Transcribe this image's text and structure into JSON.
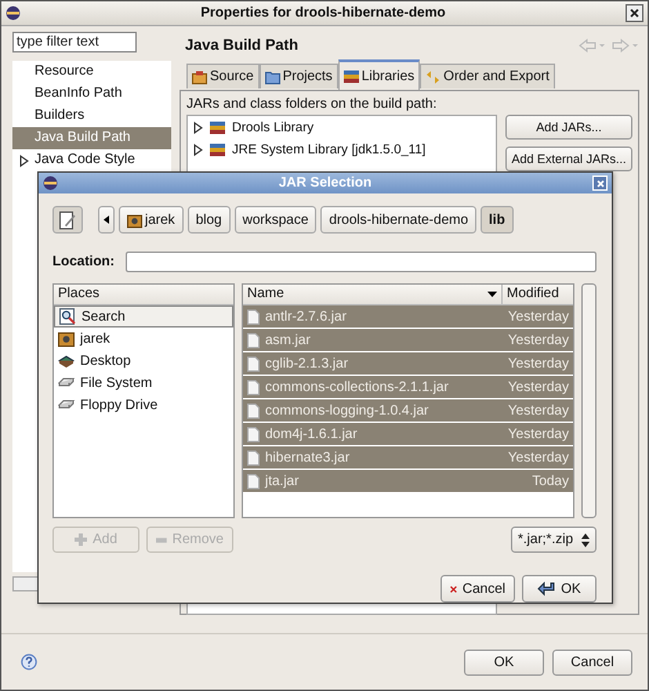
{
  "window": {
    "title": "Properties for drools-hibernate-demo"
  },
  "filter": {
    "placeholder": "type filter text"
  },
  "nav_items": [
    {
      "label": "Resource",
      "selected": false,
      "expandable": false
    },
    {
      "label": "BeanInfo Path",
      "selected": false,
      "expandable": false
    },
    {
      "label": "Builders",
      "selected": false,
      "expandable": false
    },
    {
      "label": "Java Build Path",
      "selected": true,
      "expandable": false
    },
    {
      "label": "Java Code Style",
      "selected": false,
      "expandable": true
    }
  ],
  "page": {
    "title": "Java Build Path"
  },
  "tabs": [
    {
      "label": "Source",
      "selected": false,
      "kind": "source"
    },
    {
      "label": "Projects",
      "selected": false,
      "kind": "projects"
    },
    {
      "label": "Libraries",
      "selected": true,
      "kind": "libraries"
    },
    {
      "label": "Order and Export",
      "selected": false,
      "kind": "order"
    }
  ],
  "libraries_hint": "JARs and class folders on the build path:",
  "libraries": [
    {
      "label": "Drools Library",
      "expanded": false
    },
    {
      "label": "JRE System Library [jdk1.5.0_11]",
      "expanded": false
    }
  ],
  "side_buttons": [
    "Add JARs...",
    "Add External JARs..."
  ],
  "dialog": {
    "title": "JAR Selection",
    "path": [
      {
        "label": "jarek",
        "selected": false,
        "icon": true
      },
      {
        "label": "blog",
        "selected": false,
        "icon": false
      },
      {
        "label": "workspace",
        "selected": false,
        "icon": false
      },
      {
        "label": "drools-hibernate-demo",
        "selected": false,
        "icon": false
      },
      {
        "label": "lib",
        "selected": true,
        "icon": false
      }
    ],
    "location_label": "Location:",
    "places_header": "Places",
    "places": [
      {
        "label": "Search",
        "selected": true,
        "kind": "search"
      },
      {
        "label": "jarek",
        "selected": false,
        "kind": "home"
      },
      {
        "label": "Desktop",
        "selected": false,
        "kind": "desktop"
      },
      {
        "label": "File System",
        "selected": false,
        "kind": "drive"
      },
      {
        "label": "Floppy Drive",
        "selected": false,
        "kind": "drive"
      }
    ],
    "columns": [
      "Name",
      "Modified"
    ],
    "files": [
      {
        "name": "antlr-2.7.6.jar",
        "modified": "Yesterday",
        "selected": true
      },
      {
        "name": "asm.jar",
        "modified": "Yesterday",
        "selected": true
      },
      {
        "name": "cglib-2.1.3.jar",
        "modified": "Yesterday",
        "selected": true
      },
      {
        "name": "commons-collections-2.1.1.jar",
        "modified": "Yesterday",
        "selected": true
      },
      {
        "name": "commons-logging-1.0.4.jar",
        "modified": "Yesterday",
        "selected": true
      },
      {
        "name": "dom4j-1.6.1.jar",
        "modified": "Yesterday",
        "selected": true
      },
      {
        "name": "hibernate3.jar",
        "modified": "Yesterday",
        "selected": true
      },
      {
        "name": "jta.jar",
        "modified": "Today",
        "selected": true
      }
    ],
    "add": {
      "label": "Add",
      "disabled": true
    },
    "remove": {
      "label": "Remove",
      "disabled": true
    },
    "file_filter": "*.jar;*.zip",
    "cancel": "Cancel",
    "ok": "OK"
  },
  "buttons": [
    "OK",
    "Cancel"
  ]
}
